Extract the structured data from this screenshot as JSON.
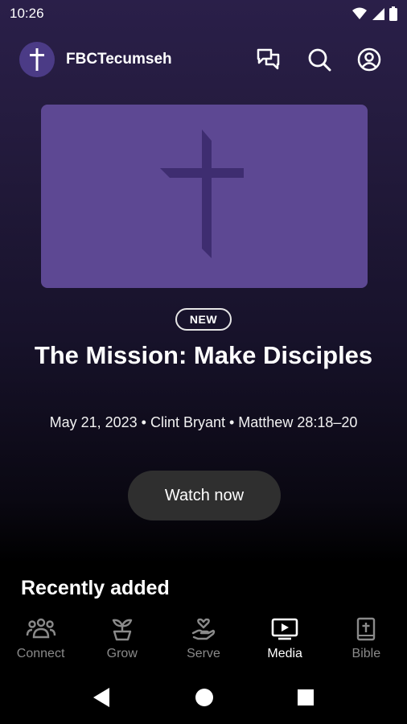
{
  "status_bar": {
    "time": "10:26"
  },
  "header": {
    "app_title": "FBCTecumseh"
  },
  "featured": {
    "badge": "NEW",
    "title": "The Mission: Make Disciples",
    "meta": "May 21, 2023 • Clint Bryant • Matthew 28:18–20",
    "watch_label": "Watch now"
  },
  "sections": {
    "recent_title": "Recently added"
  },
  "bottom_nav": {
    "items": [
      {
        "label": "Connect",
        "icon": "people-icon",
        "active": false
      },
      {
        "label": "Grow",
        "icon": "sprout-icon",
        "active": false
      },
      {
        "label": "Serve",
        "icon": "serve-hand-icon",
        "active": false
      },
      {
        "label": "Media",
        "icon": "play-screen-icon",
        "active": true
      },
      {
        "label": "Bible",
        "icon": "bible-icon",
        "active": false
      }
    ]
  },
  "colors": {
    "accent": "#5d4893",
    "avatar_bg": "#4b3b86",
    "button_bg": "#2f2f2f",
    "inactive_nav": "#8a8a8a"
  }
}
